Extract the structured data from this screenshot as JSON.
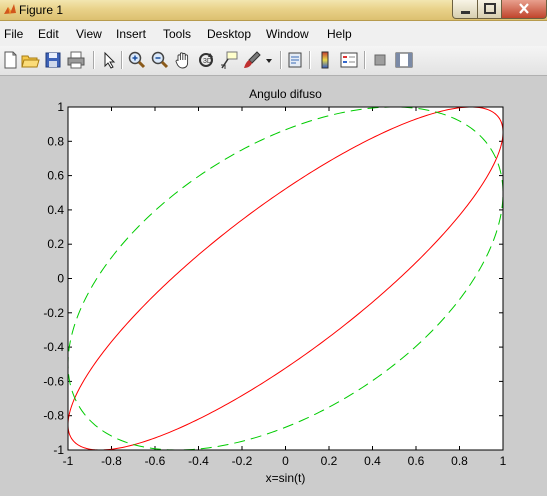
{
  "window": {
    "title": "Figure 1"
  },
  "menu": [
    "File",
    "Edit",
    "View",
    "Insert",
    "Tools",
    "Desktop",
    "Window",
    "Help"
  ],
  "toolbar_icons": [
    "new-figure-icon",
    "open-file-icon",
    "save-figure-icon",
    "print-figure-icon",
    "edit-plot-icon",
    "zoom-in-icon",
    "zoom-out-icon",
    "pan-icon",
    "rotate-3d-icon",
    "data-cursor-icon",
    "brush-icon",
    "link-plot-icon",
    "colorbar-icon",
    "legend-icon",
    "hide-plot-tools-icon",
    "show-plot-tools-icon"
  ],
  "colors": {
    "curve1": "#ff0000",
    "curve2": "#00cc00",
    "background": "#cccccc"
  },
  "chart_data": {
    "type": "line",
    "title": "Angulo difuso",
    "xlabel": "x=sin(t)",
    "ylabel": "",
    "xlim": [
      -1,
      1
    ],
    "ylim": [
      -1,
      1
    ],
    "xticks": [
      "-1",
      "-0.8",
      "-0.6",
      "-0.4",
      "-0.2",
      "0",
      "0.2",
      "0.4",
      "0.6",
      "0.8",
      "1"
    ],
    "yticks": [
      "-1",
      "-0.8",
      "-0.6",
      "-0.4",
      "-0.2",
      "0",
      "0.2",
      "0.4",
      "0.6",
      "0.8",
      "1"
    ],
    "grid": false,
    "series": [
      {
        "style": "solid",
        "color": "#ff0000",
        "x_expr": "sin(t)",
        "y_expr": "sin(t + 0.55)"
      },
      {
        "style": "dashed",
        "color": "#00cc00",
        "x_expr": "sin(t)",
        "y_expr": "sin(t + 1.05)"
      }
    ]
  }
}
